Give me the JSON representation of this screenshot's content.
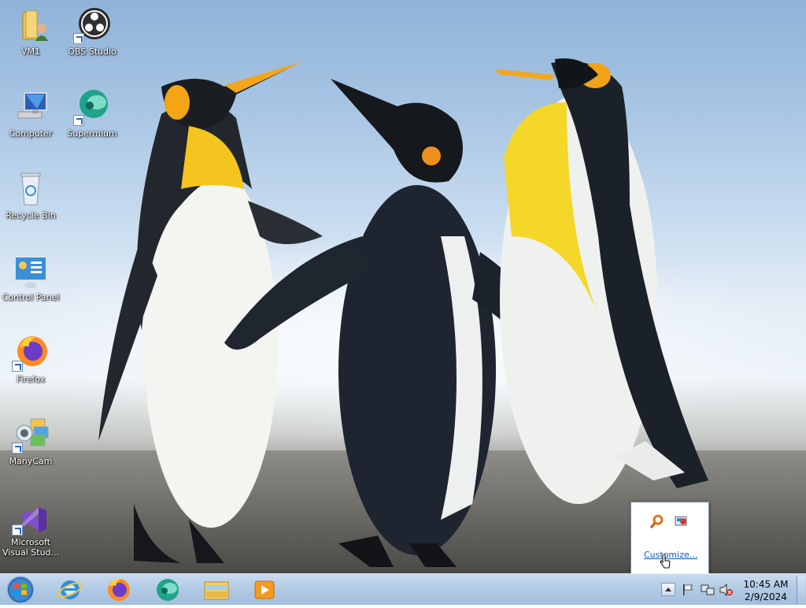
{
  "desktop_icons": [
    {
      "label": "VM1",
      "icon": "user-folder-icon"
    },
    {
      "label": "OBS Studio",
      "icon": "obs-studio-icon"
    },
    {
      "label": "Computer",
      "icon": "computer-icon"
    },
    {
      "label": "Supermium",
      "icon": "supermium-icon"
    },
    {
      "label": "Recycle Bin",
      "icon": "recycle-bin-icon"
    },
    {
      "label": "Control Panel",
      "icon": "control-panel-icon"
    },
    {
      "label": "Firefox",
      "icon": "firefox-icon"
    },
    {
      "label": "ManyCam",
      "icon": "manycam-icon"
    },
    {
      "label": "Microsoft Visual Stud...",
      "icon": "visual-studio-icon"
    }
  ],
  "tray_popup": {
    "icons": [
      "search-tool-icon",
      "network-monitor-icon"
    ],
    "customize_label": "Customize..."
  },
  "taskbar": {
    "start": "windows-start-orb-icon",
    "pinned": [
      {
        "name": "Internet Explorer",
        "icon": "internet-explorer-icon"
      },
      {
        "name": "Firefox",
        "icon": "firefox-icon"
      },
      {
        "name": "Supermium",
        "icon": "supermium-icon"
      },
      {
        "name": "Windows Explorer",
        "icon": "file-explorer-icon"
      },
      {
        "name": "Windows Media Player",
        "icon": "media-player-icon"
      }
    ],
    "tray_icons": [
      "show-hidden-icons-chevron",
      "action-center-flag-icon",
      "network-icon",
      "volume-muted-icon"
    ]
  },
  "clock": {
    "time": "10:45 AM",
    "date": "2/9/2024"
  }
}
